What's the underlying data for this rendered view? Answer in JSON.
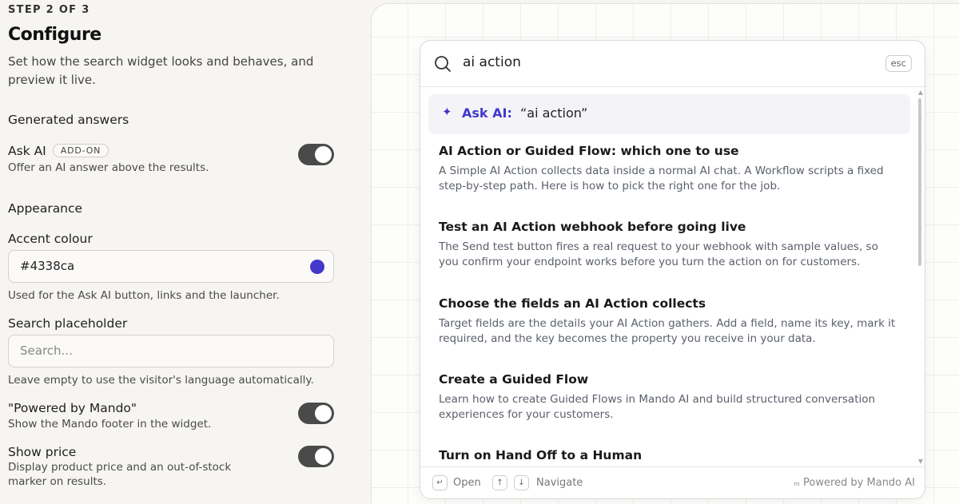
{
  "step_label": "STEP 2 OF 3",
  "page_title": "Configure",
  "page_description": "Set how the search widget looks and behaves, and preview it live.",
  "generated_answers": {
    "heading": "Generated answers",
    "ask_ai": {
      "label": "Ask AI",
      "badge": "ADD-ON",
      "help": "Offer an AI answer above the results.",
      "enabled": true
    }
  },
  "appearance": {
    "heading": "Appearance",
    "accent": {
      "label": "Accent colour",
      "value": "#4338ca",
      "help": "Used for the Ask AI button, links and the launcher."
    },
    "placeholder": {
      "label": "Search placeholder",
      "value": "",
      "placeholder": "Search...",
      "help": "Leave empty to use the visitor's language automatically."
    },
    "powered": {
      "label": "\"Powered by Mando\"",
      "help": "Show the Mando footer in the widget.",
      "enabled": true
    },
    "show_price": {
      "label": "Show price",
      "help": "Display product price and an out-of-stock marker on results.",
      "enabled": true
    }
  },
  "preview": {
    "query": "ai action",
    "esc_label": "esc",
    "ask_ai_label": "Ask AI:",
    "ask_ai_query": "“ai action”",
    "results": [
      {
        "title": "AI Action or Guided Flow: which one to use",
        "excerpt": "A Simple AI Action collects data inside a normal AI chat. A Workflow scripts a fixed step-by-step path. Here is how to pick the right one for the job."
      },
      {
        "title": "Test an AI Action webhook before going live",
        "excerpt": "The Send test button fires a real request to your webhook with sample values, so you confirm your endpoint works before you turn the action on for customers."
      },
      {
        "title": "Choose the fields an AI Action collects",
        "excerpt": "Target fields are the details your AI Action gathers. Add a field, name its key, mark it required, and the key becomes the property you receive in your data."
      },
      {
        "title": "Create a Guided Flow",
        "excerpt": "Learn how to create Guided Flows in Mando AI and build structured conversation experiences for your customers."
      },
      {
        "title": "Turn on Hand Off to a Human",
        "excerpt": ""
      }
    ],
    "footer": {
      "open_label": "Open",
      "navigate_label": "Navigate",
      "powered_label": "Powered by Mando AI",
      "enter_key": "↵",
      "up_key": "↑",
      "down_key": "↓"
    }
  },
  "colors": {
    "accent": "#4338ca",
    "toggle_on": "#4a4a4a"
  },
  "icons": [
    "search-icon",
    "sparkle-icon",
    "enter-key-icon",
    "arrow-up-icon",
    "arrow-down-icon",
    "mando-logo-icon"
  ]
}
